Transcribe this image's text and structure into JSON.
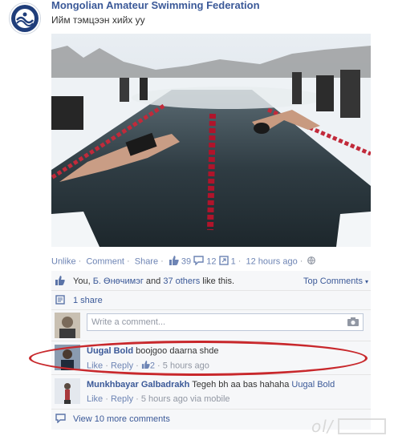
{
  "post": {
    "page_name": "Mongolian Amateur Swimming Federation",
    "text": "Ийм тэмцээн хийх уу"
  },
  "actions": {
    "like": "Unlike",
    "comment": "Comment",
    "share": "Share",
    "likes_count": "39",
    "comments_count": "12",
    "shares_count": "1",
    "time": "12 hours ago"
  },
  "likes_row": {
    "you": "You,",
    "friend": "Б. Өнөчимэг",
    "and": "and",
    "others": "37 others",
    "suffix": "like this.",
    "top_comments": "Top Comments"
  },
  "shares_row": {
    "label": "1 share"
  },
  "comment_input": {
    "placeholder": "Write a comment..."
  },
  "comments": [
    {
      "author": "Uugal Bold",
      "text": "boojgoo daarna shde",
      "like": "Like",
      "reply": "Reply",
      "likes": "2",
      "time": "5 hours ago"
    },
    {
      "author": "Munkhbayar Galbadrakh",
      "text": "Tegeh bh aa bas hahaha",
      "mention": "Uugal Bold",
      "like": "Like",
      "reply": "Reply",
      "time": "5 hours ago via mobile"
    }
  ],
  "view_more": "View 10 more comments",
  "colors": {
    "link": "#3b5998",
    "highlight": "#c8282c",
    "ufi_bg": "#f6f7f9"
  }
}
